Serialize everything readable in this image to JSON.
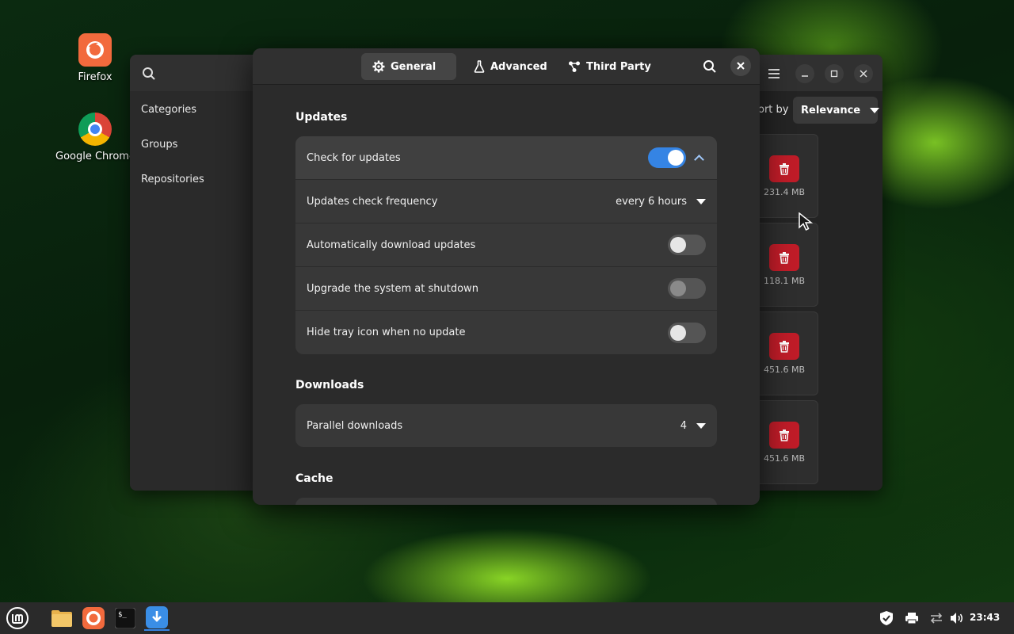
{
  "desktop": {
    "icons": [
      {
        "label": "Firefox"
      },
      {
        "label": "Google Chrome"
      }
    ]
  },
  "background_window": {
    "sidebar": {
      "items": [
        {
          "label": "Categories"
        },
        {
          "label": "Groups"
        },
        {
          "label": "Repositories"
        }
      ]
    },
    "sort_label": "ort by",
    "sort_value": "Relevance",
    "cards": [
      {
        "size": "231.4 MB"
      },
      {
        "size": "118.1 MB"
      },
      {
        "size": "451.6 MB"
      },
      {
        "size": "451.6 MB"
      }
    ]
  },
  "dialog": {
    "tabs": [
      {
        "label": "General",
        "icon": "gear-icon",
        "active": true
      },
      {
        "label": "Advanced",
        "icon": "flask-icon",
        "active": false
      },
      {
        "label": "Third Party",
        "icon": "share-icon",
        "active": false
      }
    ],
    "sections": {
      "updates": {
        "title": "Updates",
        "rows": [
          {
            "label": "Check for updates",
            "type": "switch",
            "on": true
          },
          {
            "label": "Updates check frequency",
            "type": "dropdown",
            "value": "every 6 hours"
          },
          {
            "label": "Automatically download updates",
            "type": "switch",
            "on": false
          },
          {
            "label": "Upgrade the system at shutdown",
            "type": "switch",
            "on": false
          },
          {
            "label": "Hide tray icon when no update",
            "type": "switch",
            "on": false
          }
        ]
      },
      "downloads": {
        "title": "Downloads",
        "rows": [
          {
            "label": "Parallel downloads",
            "type": "dropdown",
            "value": "4"
          }
        ]
      },
      "cache": {
        "title": "Cache"
      }
    }
  },
  "taskbar": {
    "clock": "23:43"
  },
  "colors": {
    "accent": "#3584e4",
    "danger": "#c01c28",
    "firefox": "#f26a3d"
  }
}
